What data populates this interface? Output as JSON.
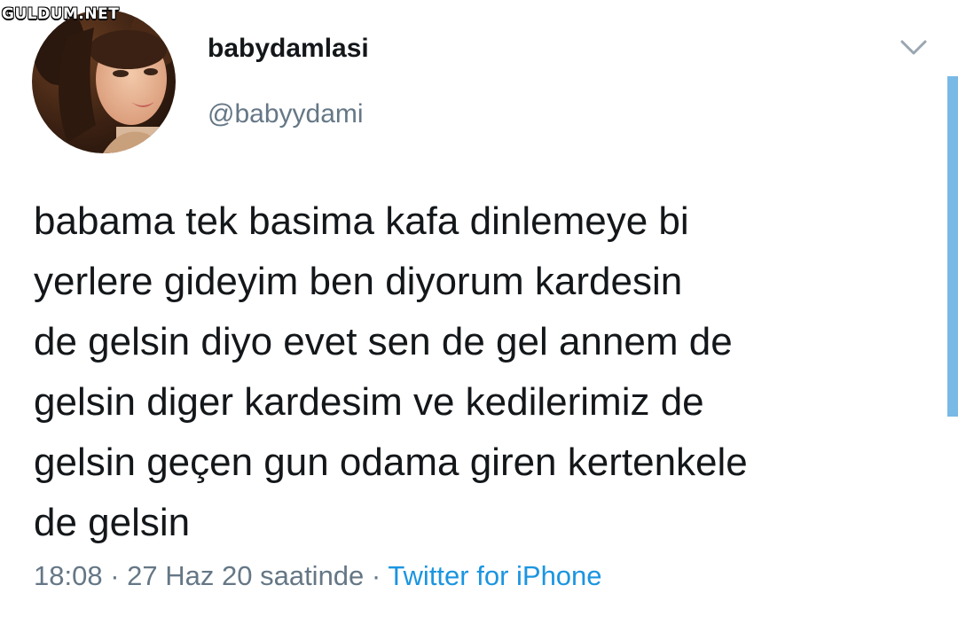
{
  "watermark": "GULDUM.NET",
  "user": {
    "display_name": "babydamlasi",
    "handle": "@babyydami"
  },
  "tweet": {
    "lines": [
      "babama tek basima kafa dinlemeye bi",
      "yerlere gideyim ben diyorum kardesin",
      "de gelsin diyo evet sen de gel annem de",
      "gelsin diger kardesim ve kedilerimiz de",
      "gelsin geçen gun odama giren kertenkele",
      "de gelsin"
    ]
  },
  "meta": {
    "time": "18:08",
    "separator": "·",
    "date": "27 Haz 20 saatinde",
    "source": "Twitter for iPhone"
  },
  "icons": {
    "menu": "chevron-down-icon"
  },
  "colors": {
    "text": "#14171a",
    "secondary": "#657786",
    "link": "#1b95e0",
    "scrollbar": "#79b9e6"
  }
}
